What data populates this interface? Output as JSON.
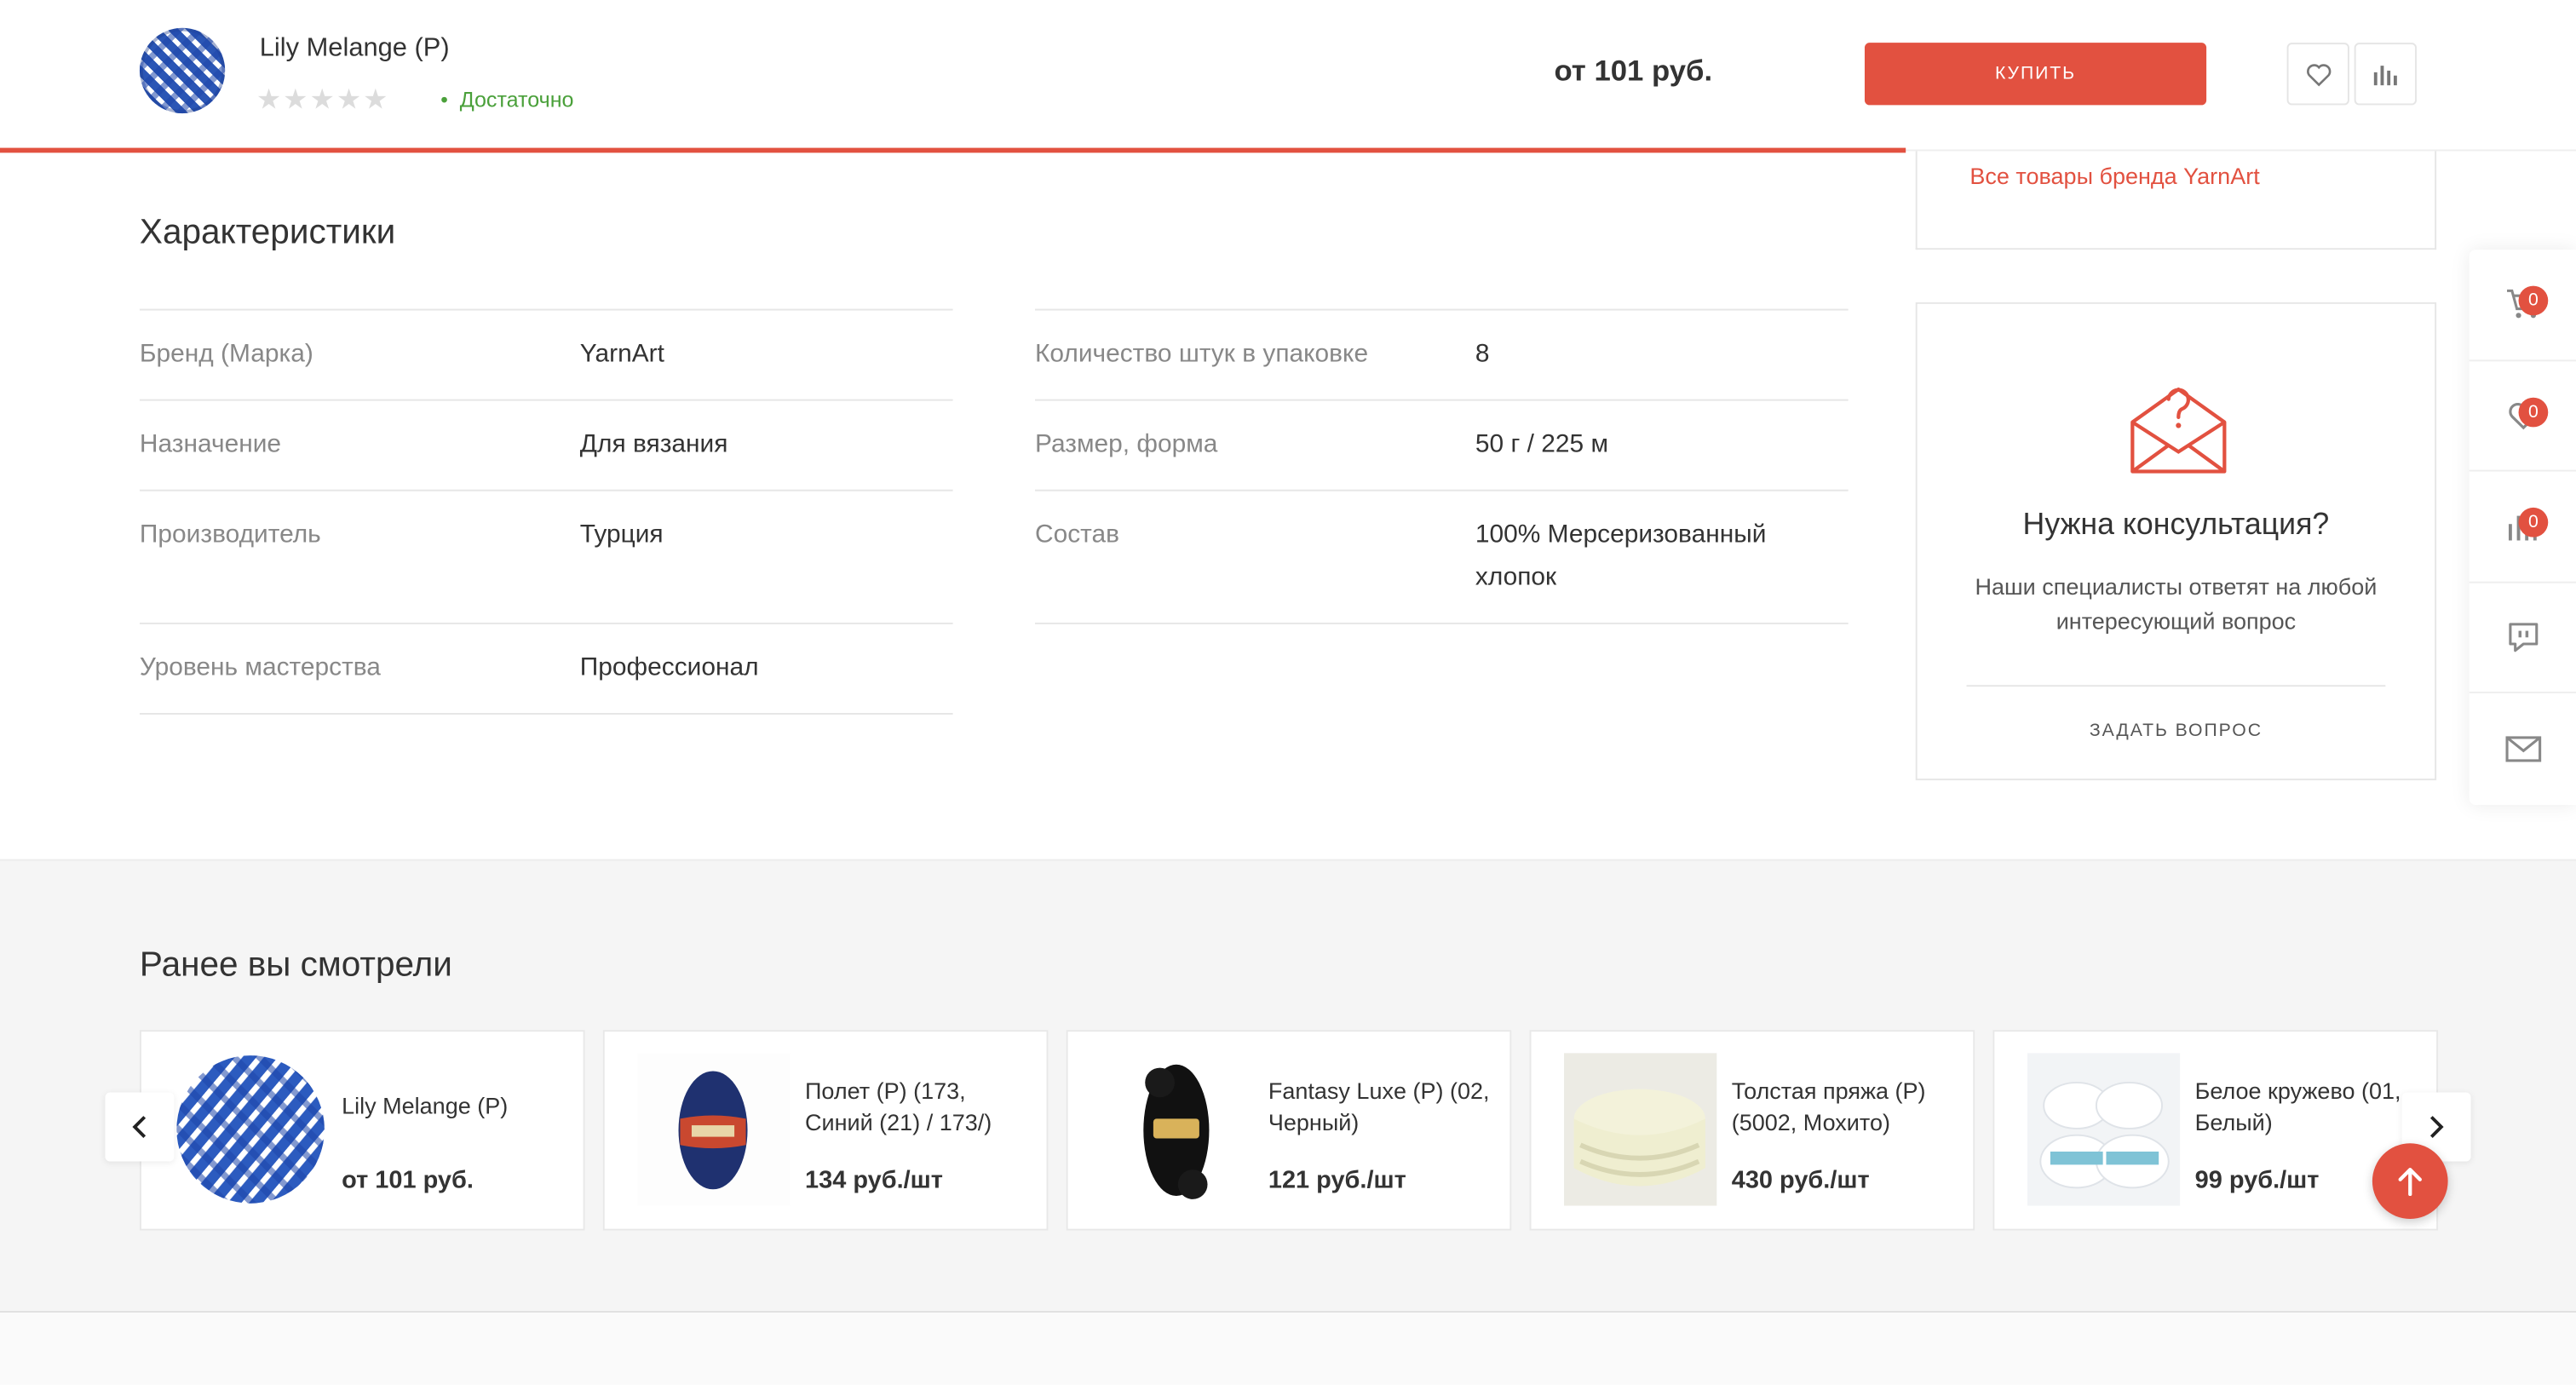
{
  "header": {
    "product_name": "Lily Melange (P)",
    "stars": "★★★★★",
    "stock": "Достаточно",
    "price": "от 101 руб.",
    "buy_label": "КУПИТЬ",
    "reading_progress": 0.74
  },
  "brand_card": {
    "link": "Все товары бренда YarnArt"
  },
  "characteristics": {
    "title": "Характеристики",
    "left": [
      {
        "key": "Бренд (Марка)",
        "value": "YarnArt"
      },
      {
        "key": "Назначение",
        "value": "Для вязания"
      },
      {
        "key": "Производитель",
        "value": "Турция"
      },
      {
        "key": "Уровень мастерства",
        "value": "Профессионал"
      }
    ],
    "right": [
      {
        "key": "Количество штук в упаковке",
        "value": "8"
      },
      {
        "key": "Размер, форма",
        "value": "50 г / 225 м"
      },
      {
        "key": "Состав",
        "value": "100% Мерсеризованный хлопок"
      }
    ]
  },
  "consult": {
    "title": "Нужна консультация?",
    "text": "Наши специалисты ответят на любой интересующий вопрос",
    "ask": "ЗАДАТЬ ВОПРОС"
  },
  "side_panel": {
    "cart_count": "0",
    "favorites_count": "0",
    "compare_count": "0"
  },
  "viewed": {
    "title": "Ранее вы смотрели",
    "items": [
      {
        "name": "Lily Melange (P)",
        "price": "от 101 руб."
      },
      {
        "name": "Полет (Р) (173, Синий (21) / 173/)",
        "price": "134 руб./шт"
      },
      {
        "name": "Fantasy Luxe (Р) (02, Черный)",
        "price": "121 руб./шт"
      },
      {
        "name": "Толстая пряжа (Р) (5002, Мохито)",
        "price": "430 руб./шт"
      },
      {
        "name": "Белое кружево (01, Белый)",
        "price": "99 руб./шт"
      }
    ]
  },
  "colors": {
    "accent": "#e25140",
    "stock_green": "#4aa03a"
  }
}
